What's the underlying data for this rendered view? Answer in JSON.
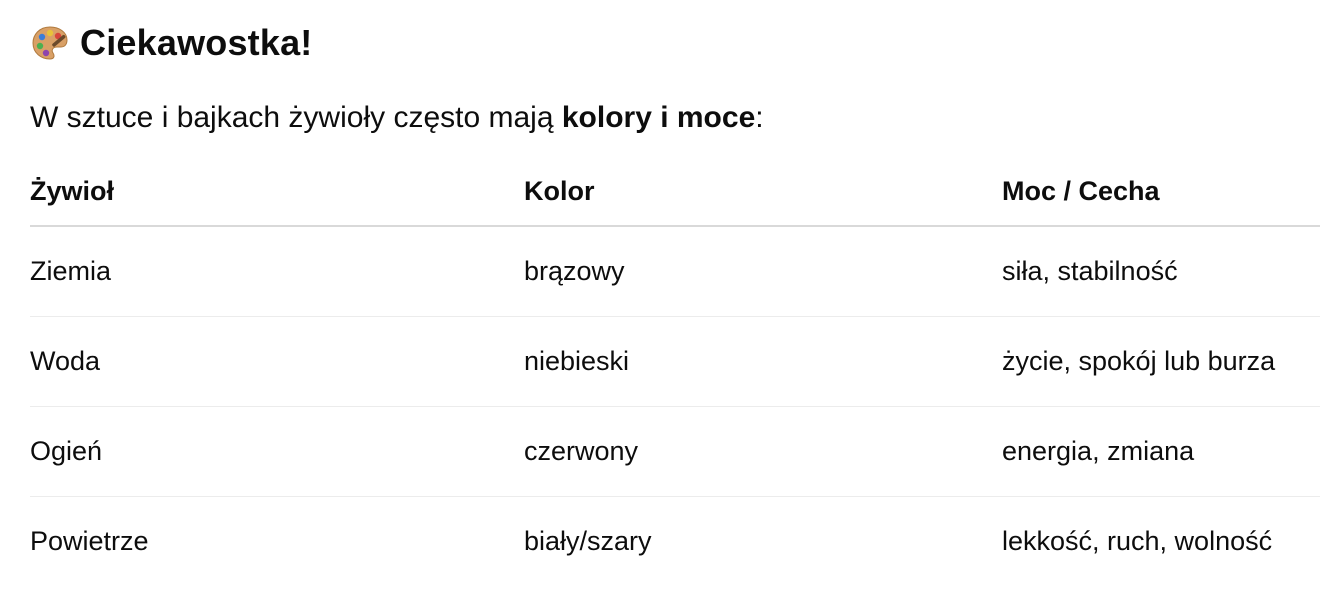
{
  "heading": {
    "icon": "palette-icon",
    "title": "Ciekawostka!"
  },
  "intro": {
    "text_before": "W sztuce i bajkach żywioły często mają ",
    "bold": "kolory i moce",
    "text_after": ":"
  },
  "table": {
    "headers": [
      "Żywioł",
      "Kolor",
      "Moc / Cecha"
    ],
    "rows": [
      [
        "Ziemia",
        "brązowy",
        "siła, stabilność"
      ],
      [
        "Woda",
        "niebieski",
        "życie, spokój lub burza"
      ],
      [
        "Ogień",
        "czerwony",
        "energia, zmiana"
      ],
      [
        "Powietrze",
        "biały/szary",
        "lekkość, ruch, wolność"
      ]
    ]
  },
  "colors": {
    "text": "#0d0d0d",
    "header_rule": "#d9d9d9",
    "row_rule": "#ececec"
  }
}
